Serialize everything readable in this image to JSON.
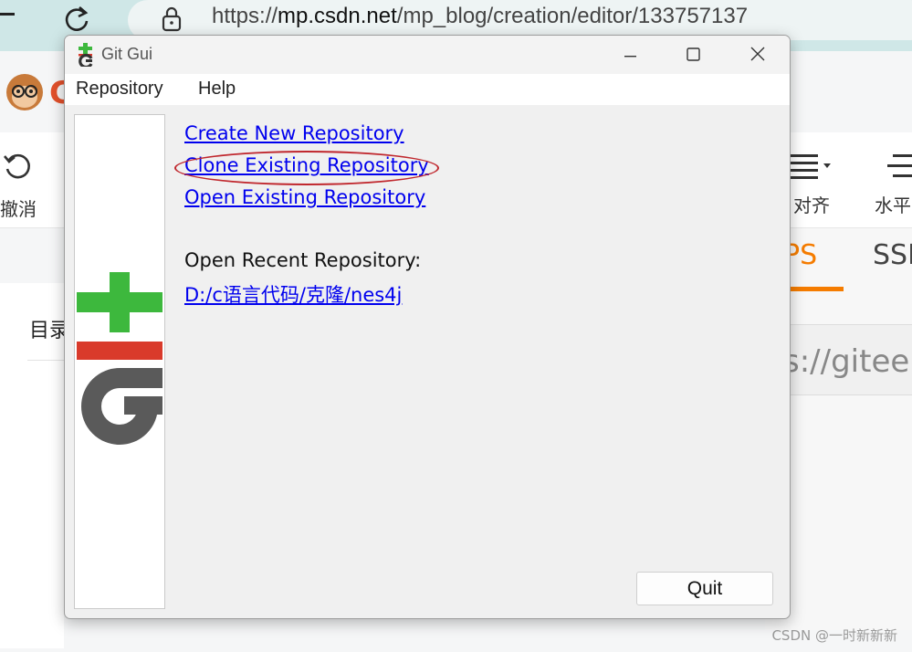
{
  "browser": {
    "url_prefix": "https://",
    "url_domain": "mp.csdn.net",
    "url_path": "/mp_blog/creation/editor/133757137",
    "toolbar_labels": {
      "undo": "撤消",
      "align": "对齐",
      "horizontal": "水平"
    },
    "background_text": {
      "toc": "目录",
      "tab_https_fragment": "PS",
      "tab_ssh_fragment": "SSI",
      "url_fragment": "s://gitee",
      "brand_fragment": "C"
    },
    "watermark": "CSDN @一时新新新"
  },
  "window": {
    "title": "Git Gui",
    "menu": [
      "Repository",
      "Help"
    ],
    "actions": {
      "create": "Create New Repository",
      "clone": "Clone Existing Repository",
      "open": "Open Existing Repository"
    },
    "recent_label": "Open Recent Repository:",
    "recent_items": [
      "D:/c语言代码/克隆/nes4j"
    ],
    "quit_label": "Quit"
  },
  "icons": [
    "reload-icon",
    "lock-icon",
    "git-app-icon",
    "minimize-icon",
    "maximize-icon",
    "close-icon",
    "git-logo",
    "undo-icon",
    "align-icon",
    "menu-lines-icon"
  ],
  "colors": {
    "accent_orange": "#f57c00",
    "link_blue": "#0000ee",
    "highlight_red": "#c0272d",
    "git_green": "#3db83d",
    "git_red": "#d93a2b",
    "git_gray": "#5a5a5a"
  }
}
